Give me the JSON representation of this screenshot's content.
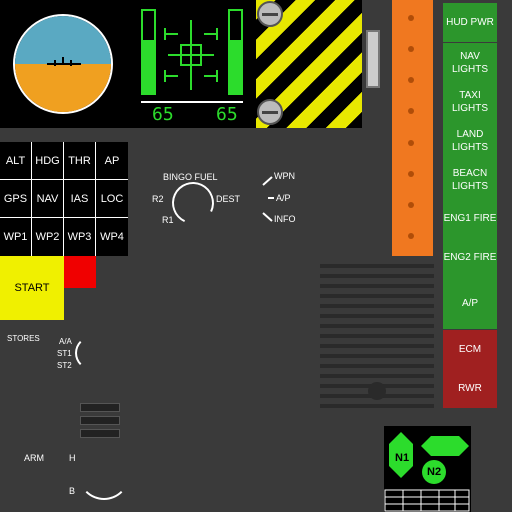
{
  "hud": {
    "left_value": "65",
    "right_value": "65",
    "left_level": 0.65,
    "right_level": 0.65
  },
  "keypad": {
    "keys": [
      "ALT",
      "HDG",
      "THR",
      "AP",
      "GPS",
      "NAV",
      "IAS",
      "LOC",
      "WP1",
      "WP2",
      "WP3",
      "WP4"
    ]
  },
  "fuel_knob": {
    "title": "BINGO FUEL",
    "left_upper": "R2",
    "left_lower": "R1",
    "right": "DEST"
  },
  "mode_switch": {
    "top": "WPN",
    "mid": "A/P",
    "bottom": "INFO"
  },
  "start_button": "START",
  "stores_knob": {
    "title": "STORES",
    "opt1": "A/A",
    "opt2": "ST1",
    "opt3": "ST2"
  },
  "arm_switch": {
    "title": "ARM",
    "high": "H",
    "low": "B"
  },
  "right_buttons": [
    {
      "label": "HUD PWR",
      "color": "green"
    },
    {
      "label": "NAV LIGHTS",
      "color": "green"
    },
    {
      "label": "TAXI LIGHTS",
      "color": "green"
    },
    {
      "label": "LAND LIGHTS",
      "color": "green"
    },
    {
      "label": "BEACN LIGHTS",
      "color": "green"
    },
    {
      "label": "ENG1 FIRE",
      "color": "green"
    },
    {
      "label": "ENG2 FIRE",
      "color": "green"
    },
    {
      "label": "A/P",
      "color": "green"
    },
    {
      "label": "ECM",
      "color": "red"
    },
    {
      "label": "RWR",
      "color": "red"
    }
  ],
  "engine_display": {
    "n1": "N1",
    "n2": "N2"
  },
  "colors": {
    "accent_green": "#2cdc2c",
    "panel": "#3a3a3a",
    "warning_yellow": "#f0f000",
    "orange": "#f07820"
  }
}
